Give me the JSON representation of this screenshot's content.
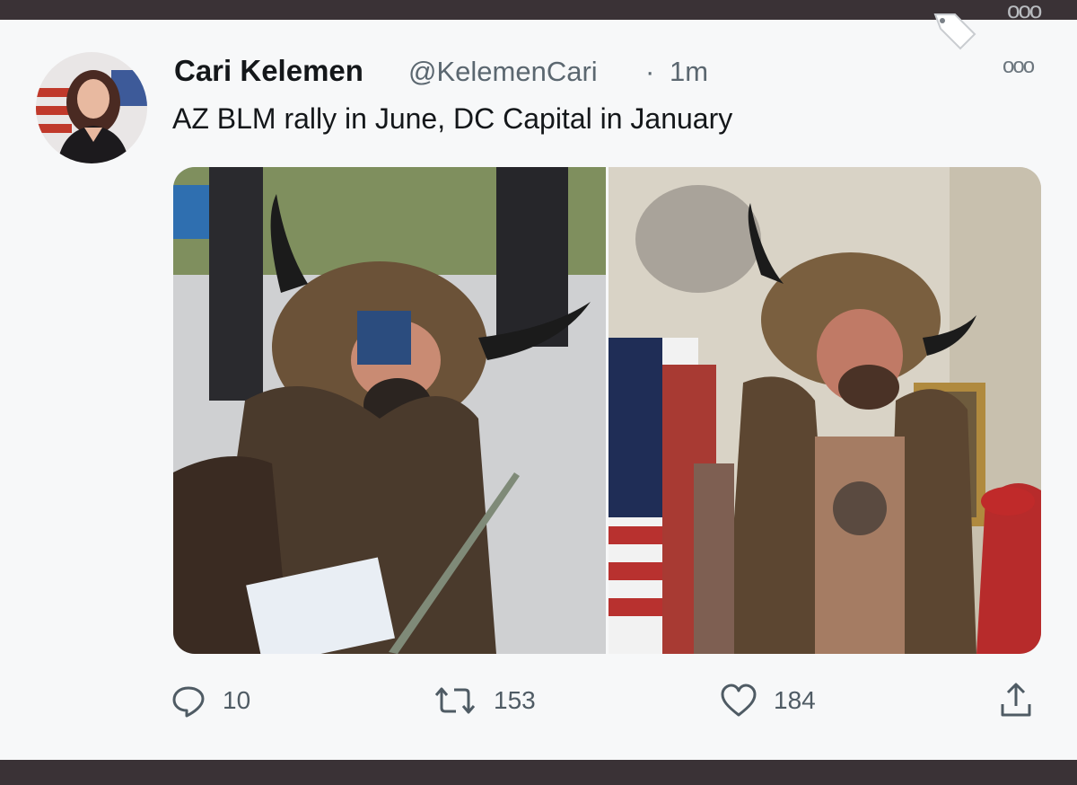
{
  "tweet": {
    "author_name": "Cari Kelemen",
    "handle": "@KelemenCari",
    "separator": "·",
    "time": "1m",
    "text": "AZ BLM rally in June, DC Capital in January",
    "more_glyph": "ooo",
    "top_more_glyph": "ooo"
  },
  "actions": {
    "reply": {
      "icon": "reply-icon",
      "count": "10"
    },
    "retweet": {
      "icon": "retweet-icon",
      "count": "153"
    },
    "like": {
      "icon": "heart-icon",
      "count": "184"
    },
    "share": {
      "icon": "share-icon"
    }
  },
  "colors": {
    "text_primary": "#14171a",
    "text_secondary": "#5b6770",
    "background": "#f7f8f9",
    "frame_border": "#3a3236"
  }
}
